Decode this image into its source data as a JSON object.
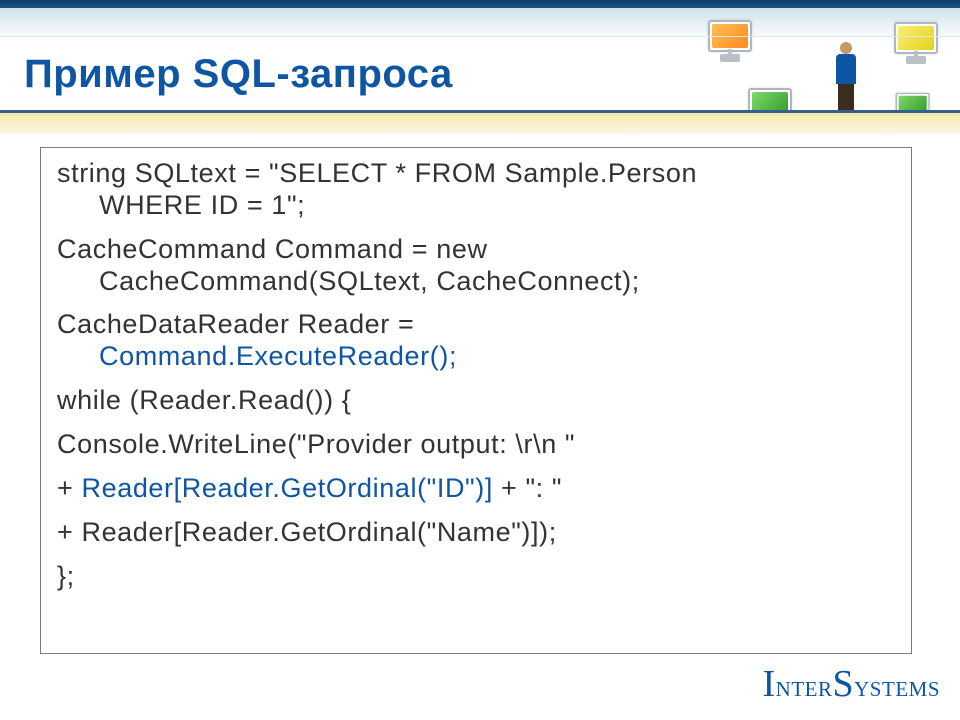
{
  "title": "Пример SQL-запроса",
  "code": {
    "l1a": "string SQLtext = \"SELECT * FROM Sample.Person",
    "l1b": "WHERE ID = 1\";",
    "l2a": "CacheCommand Command = new",
    "l2b": "CacheCommand(SQLtext, CacheConnect);",
    "l3a": "CacheDataReader Reader =",
    "l3b": "Command.ExecuteReader();",
    "l4": "while (Reader.Read()) {",
    "l5": "Console.WriteLine(\"Provider output: \\r\\n \"",
    "l6a": "+ ",
    "l6b": "Reader[Reader.GetOrdinal(\"ID\")]",
    "l6c": " + \": \"",
    "l7": "+ Reader[Reader.GetOrdinal(\"Name\")]);",
    "l8": "};"
  },
  "logo": {
    "prefix": "I",
    "rest1": "nter",
    "mid": "S",
    "rest2": "ystems"
  }
}
